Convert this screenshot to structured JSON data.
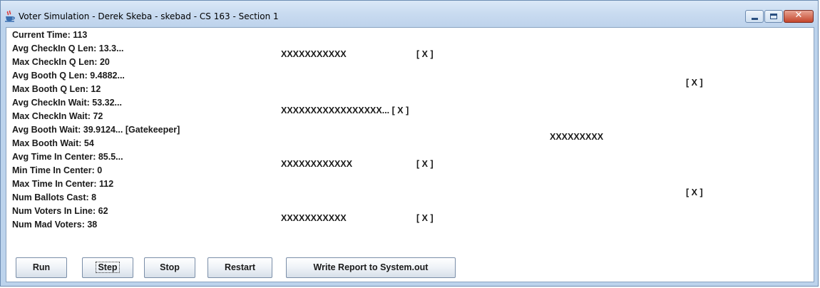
{
  "window": {
    "title": "Voter Simulation - Derek Skeba - skebad - CS 163 - Section 1",
    "icon": "java-coffee-cup-icon"
  },
  "stats": [
    "Current Time: 113",
    "Avg CheckIn Q Len: 13.3...",
    "Max CheckIn Q Len: 20",
    "Avg Booth Q Len: 9.4882...",
    "Max Booth Q Len: 12",
    "Avg CheckIn Wait: 53.32...",
    "Max CheckIn Wait: 72",
    "Avg Booth Wait: 39.9124... [Gatekeeper]",
    "Max Booth Wait: 54",
    "Avg Time In Center: 85.5...",
    "Min Time In Center: 0",
    "Max Time In Center: 112",
    "Num Ballots Cast: 8",
    "Num Voters In Line: 62",
    "Num Mad Voters: 38"
  ],
  "queues": {
    "checkin_1": "XXXXXXXXXXX",
    "checkin_1_booth": "[ X ]",
    "checkin_2": "XXXXXXXXXXXXXXXXX... [ X ]",
    "checkin_3": "XXXXXXXXXXXX",
    "checkin_3_booth": "[ X ]",
    "checkin_4": "XXXXXXXXXXX",
    "checkin_4_booth": "[ X ]",
    "booth_queue": "XXXXXXXXX",
    "booth_1": "[ X ]",
    "booth_2": "[ X ]"
  },
  "buttons": {
    "run": "Run",
    "step": "Step",
    "stop": "Stop",
    "restart": "Restart",
    "report": "Write Report to System.out"
  }
}
